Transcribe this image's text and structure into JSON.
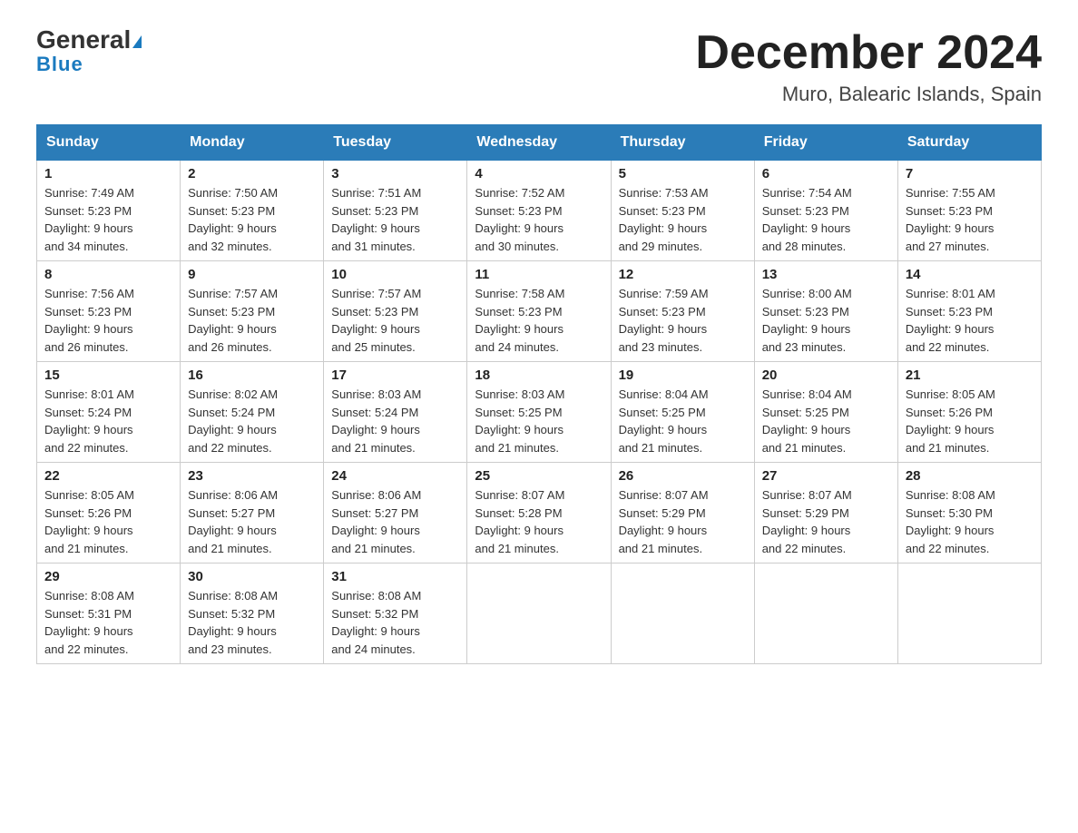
{
  "header": {
    "logo_general": "General",
    "logo_blue": "Blue",
    "month_title": "December 2024",
    "location": "Muro, Balearic Islands, Spain"
  },
  "weekdays": [
    "Sunday",
    "Monday",
    "Tuesday",
    "Wednesday",
    "Thursday",
    "Friday",
    "Saturday"
  ],
  "weeks": [
    [
      {
        "day": "1",
        "sunrise": "7:49 AM",
        "sunset": "5:23 PM",
        "daylight": "9 hours and 34 minutes."
      },
      {
        "day": "2",
        "sunrise": "7:50 AM",
        "sunset": "5:23 PM",
        "daylight": "9 hours and 32 minutes."
      },
      {
        "day": "3",
        "sunrise": "7:51 AM",
        "sunset": "5:23 PM",
        "daylight": "9 hours and 31 minutes."
      },
      {
        "day": "4",
        "sunrise": "7:52 AM",
        "sunset": "5:23 PM",
        "daylight": "9 hours and 30 minutes."
      },
      {
        "day": "5",
        "sunrise": "7:53 AM",
        "sunset": "5:23 PM",
        "daylight": "9 hours and 29 minutes."
      },
      {
        "day": "6",
        "sunrise": "7:54 AM",
        "sunset": "5:23 PM",
        "daylight": "9 hours and 28 minutes."
      },
      {
        "day": "7",
        "sunrise": "7:55 AM",
        "sunset": "5:23 PM",
        "daylight": "9 hours and 27 minutes."
      }
    ],
    [
      {
        "day": "8",
        "sunrise": "7:56 AM",
        "sunset": "5:23 PM",
        "daylight": "9 hours and 26 minutes."
      },
      {
        "day": "9",
        "sunrise": "7:57 AM",
        "sunset": "5:23 PM",
        "daylight": "9 hours and 26 minutes."
      },
      {
        "day": "10",
        "sunrise": "7:57 AM",
        "sunset": "5:23 PM",
        "daylight": "9 hours and 25 minutes."
      },
      {
        "day": "11",
        "sunrise": "7:58 AM",
        "sunset": "5:23 PM",
        "daylight": "9 hours and 24 minutes."
      },
      {
        "day": "12",
        "sunrise": "7:59 AM",
        "sunset": "5:23 PM",
        "daylight": "9 hours and 23 minutes."
      },
      {
        "day": "13",
        "sunrise": "8:00 AM",
        "sunset": "5:23 PM",
        "daylight": "9 hours and 23 minutes."
      },
      {
        "day": "14",
        "sunrise": "8:01 AM",
        "sunset": "5:23 PM",
        "daylight": "9 hours and 22 minutes."
      }
    ],
    [
      {
        "day": "15",
        "sunrise": "8:01 AM",
        "sunset": "5:24 PM",
        "daylight": "9 hours and 22 minutes."
      },
      {
        "day": "16",
        "sunrise": "8:02 AM",
        "sunset": "5:24 PM",
        "daylight": "9 hours and 22 minutes."
      },
      {
        "day": "17",
        "sunrise": "8:03 AM",
        "sunset": "5:24 PM",
        "daylight": "9 hours and 21 minutes."
      },
      {
        "day": "18",
        "sunrise": "8:03 AM",
        "sunset": "5:25 PM",
        "daylight": "9 hours and 21 minutes."
      },
      {
        "day": "19",
        "sunrise": "8:04 AM",
        "sunset": "5:25 PM",
        "daylight": "9 hours and 21 minutes."
      },
      {
        "day": "20",
        "sunrise": "8:04 AM",
        "sunset": "5:25 PM",
        "daylight": "9 hours and 21 minutes."
      },
      {
        "day": "21",
        "sunrise": "8:05 AM",
        "sunset": "5:26 PM",
        "daylight": "9 hours and 21 minutes."
      }
    ],
    [
      {
        "day": "22",
        "sunrise": "8:05 AM",
        "sunset": "5:26 PM",
        "daylight": "9 hours and 21 minutes."
      },
      {
        "day": "23",
        "sunrise": "8:06 AM",
        "sunset": "5:27 PM",
        "daylight": "9 hours and 21 minutes."
      },
      {
        "day": "24",
        "sunrise": "8:06 AM",
        "sunset": "5:27 PM",
        "daylight": "9 hours and 21 minutes."
      },
      {
        "day": "25",
        "sunrise": "8:07 AM",
        "sunset": "5:28 PM",
        "daylight": "9 hours and 21 minutes."
      },
      {
        "day": "26",
        "sunrise": "8:07 AM",
        "sunset": "5:29 PM",
        "daylight": "9 hours and 21 minutes."
      },
      {
        "day": "27",
        "sunrise": "8:07 AM",
        "sunset": "5:29 PM",
        "daylight": "9 hours and 22 minutes."
      },
      {
        "day": "28",
        "sunrise": "8:08 AM",
        "sunset": "5:30 PM",
        "daylight": "9 hours and 22 minutes."
      }
    ],
    [
      {
        "day": "29",
        "sunrise": "8:08 AM",
        "sunset": "5:31 PM",
        "daylight": "9 hours and 22 minutes."
      },
      {
        "day": "30",
        "sunrise": "8:08 AM",
        "sunset": "5:32 PM",
        "daylight": "9 hours and 23 minutes."
      },
      {
        "day": "31",
        "sunrise": "8:08 AM",
        "sunset": "5:32 PM",
        "daylight": "9 hours and 24 minutes."
      },
      null,
      null,
      null,
      null
    ]
  ],
  "labels": {
    "sunrise": "Sunrise: ",
    "sunset": "Sunset: ",
    "daylight": "Daylight: "
  }
}
